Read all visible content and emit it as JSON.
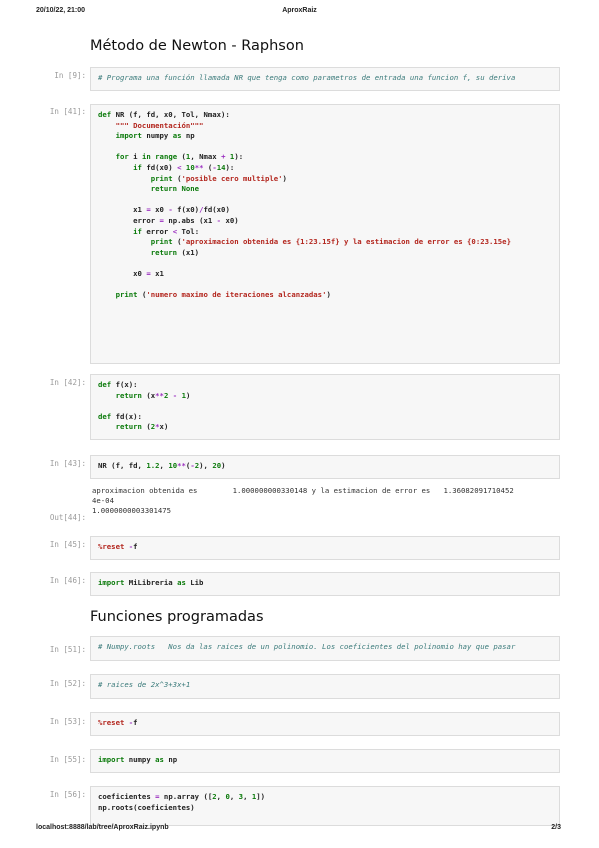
{
  "header": {
    "datetime": "20/10/22, 21:00",
    "title": "AproxRaiz"
  },
  "footer": {
    "url": "localhost:8888/lab/tree/AproxRaiz.ipynb",
    "page": "2/3"
  },
  "headings": {
    "newton": "Método de Newton - Raphson",
    "funciones": "Funciones programadas"
  },
  "prompts": {
    "p1": "In [9]:",
    "p2": "In [41]:",
    "p3": "In [42]:",
    "p4": "In [43]:",
    "p4out": "Out[44]:",
    "p5": "In [45]:",
    "p6": "In [46]:",
    "p7": "In [51]:",
    "p8": "In [52]:",
    "p9": "In [53]:",
    "p10": "In [55]:",
    "p11": "In [56]:"
  },
  "cells": {
    "c1": [
      "# Programa una función llamada NR que tenga como parametros de entrada una funcion f, su deriva"
    ],
    "c2": [
      "def NR (f, fd, x0, Tol, Nmax):",
      "    \"\"\" Documentación\"\"\"",
      "    import numpy as np",
      "",
      "    for i in range (1, Nmax + 1):",
      "        if fd(x0) < 10** (-14):",
      "            print ('posible cero multiple')",
      "            return None",
      "",
      "        x1 = x0 - f(x0)/fd(x0)",
      "        error = np.abs (x1 - x0)",
      "        if error < Tol:",
      "            print ('aproximacion obtenida es {1:23.15f} y la estimacion de error es {0:23.15e}",
      "            return (x1)",
      "",
      "        x0 = x1",
      "",
      "    print ('numero maximo de iteraciones alcanzadas')"
    ],
    "c3": [
      "def f(x):",
      "    return (x**2 - 1)",
      "",
      "def fd(x):",
      "    return (2*x)"
    ],
    "c4": [
      "NR (f, fd, 1.2, 10**(-2), 20)"
    ],
    "c4out": [
      "aproximacion obtenida es        1.000000000330148 y la estimacion de error es   1.36082091710452",
      "4e-04",
      "1.0000000003301475"
    ],
    "c5": [
      "%reset -f"
    ],
    "c6": [
      "import MiLibreria as Lib"
    ],
    "c7": [
      "# Numpy.roots   Nos da las raices de un polinomio. Los coeficientes del polinomio hay que pasar"
    ],
    "c8": [
      "# raices de 2x^3+3x+1"
    ],
    "c9": [
      "%reset -f"
    ],
    "c10": [
      "import numpy as np"
    ],
    "c11": [
      "coeficientes = np.array ([2, 0, 3, 1])",
      "np.roots(coeficientes)"
    ]
  }
}
